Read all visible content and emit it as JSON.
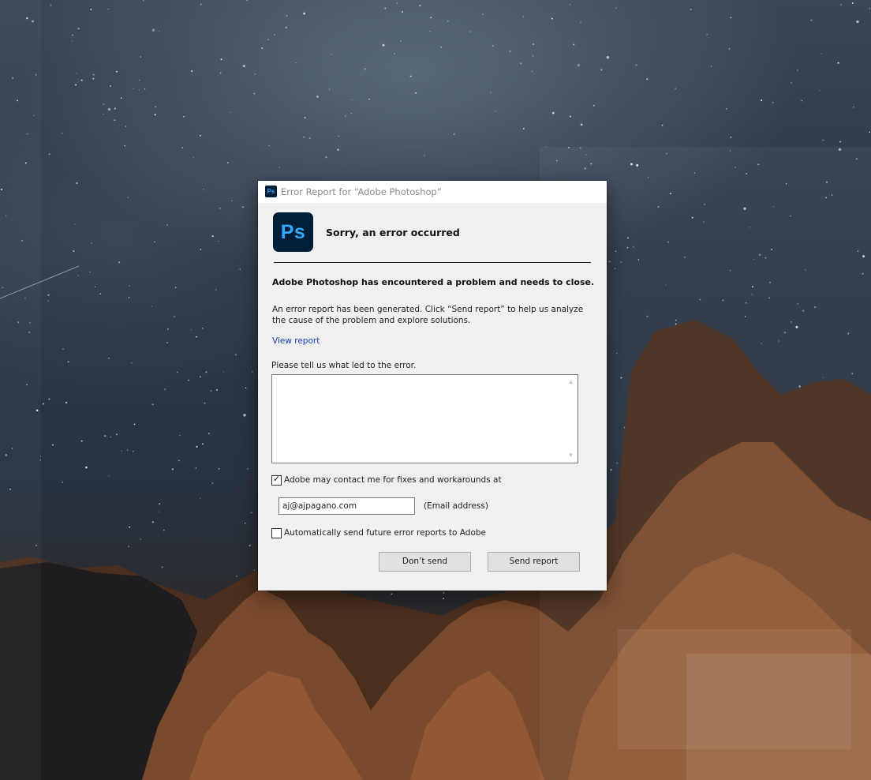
{
  "window": {
    "title": "Error Report for “Adobe Photoshop”",
    "app_icon_text": "Ps"
  },
  "header": {
    "logo_text": "Ps",
    "heading": "Sorry, an error occurred"
  },
  "body": {
    "problem": "Adobe Photoshop has encountered a problem and needs to close.",
    "description": "An error report has been generated. Click “Send report” to help us analyze the cause of the problem and explore solutions.",
    "view_report_link": "View report",
    "comment_label": "Please tell us what led to the error.",
    "comment_value": ""
  },
  "contact": {
    "checkbox_label": "Adobe may contact me for fixes and workarounds at",
    "checked": true,
    "email_value": "aj@ajpagano.com",
    "email_hint": "(Email address)"
  },
  "auto_send": {
    "checkbox_label": "Automatically send future error reports to Adobe",
    "checked": false
  },
  "buttons": {
    "dont_send": "Don’t send",
    "send_report": "Send report"
  },
  "colors": {
    "ps_background": "#001e36",
    "ps_accent": "#31a8ff",
    "link": "#1a3ab8"
  }
}
